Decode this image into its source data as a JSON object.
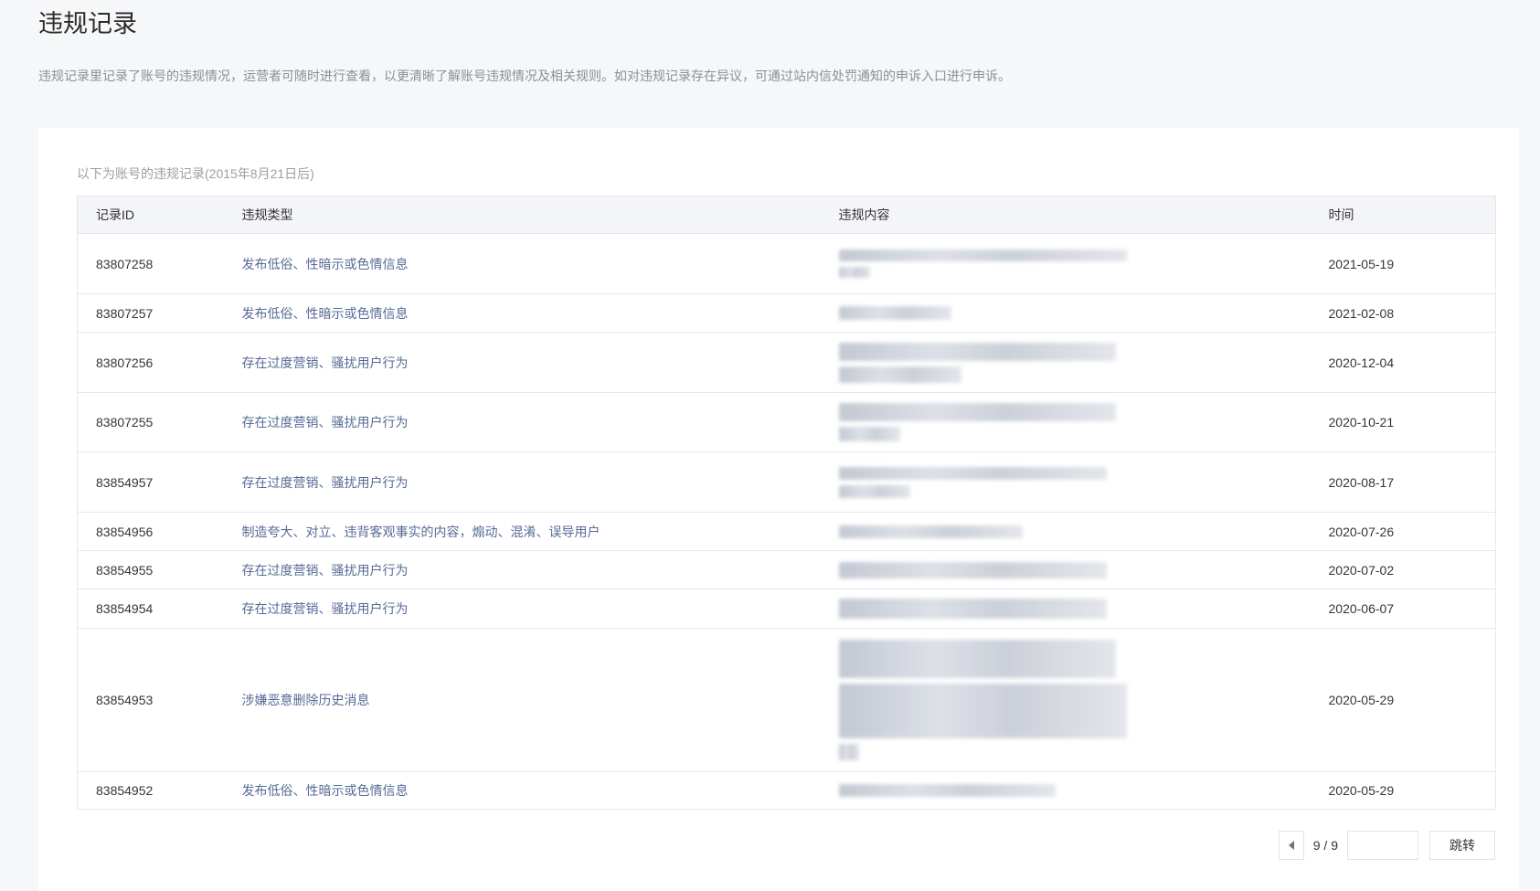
{
  "page": {
    "title": "违规记录",
    "description": "违规记录里记录了账号的违规情况，运营者可随时进行查看，以更清晰了解账号违规情况及相关规则。如对违规记录存在异议，可通过站内信处罚通知的申诉入口进行申诉。"
  },
  "table": {
    "caption": "以下为账号的违规记录(2015年8月21日后)",
    "headers": {
      "id": "记录ID",
      "type": "违规类型",
      "content": "违规内容",
      "time": "时间"
    },
    "rows": [
      {
        "id": "83807258",
        "type": "发布低俗、性暗示或色情信息",
        "time": "2021-05-19"
      },
      {
        "id": "83807257",
        "type": "发布低俗、性暗示或色情信息",
        "time": "2021-02-08"
      },
      {
        "id": "83807256",
        "type": "存在过度营销、骚扰用户行为",
        "time": "2020-12-04"
      },
      {
        "id": "83807255",
        "type": "存在过度营销、骚扰用户行为",
        "time": "2020-10-21"
      },
      {
        "id": "83854957",
        "type": "存在过度营销、骚扰用户行为",
        "time": "2020-08-17"
      },
      {
        "id": "83854956",
        "type": "制造夸大、对立、违背客观事实的内容，煽动、混淆、误导用户",
        "time": "2020-07-26"
      },
      {
        "id": "83854955",
        "type": "存在过度营销、骚扰用户行为",
        "time": "2020-07-02"
      },
      {
        "id": "83854954",
        "type": "存在过度营销、骚扰用户行为",
        "time": "2020-06-07"
      },
      {
        "id": "83854953",
        "type": "涉嫌恶意删除历史消息",
        "time": "2020-05-29"
      },
      {
        "id": "83854952",
        "type": "发布低俗、性暗示或色情信息",
        "time": "2020-05-29"
      }
    ]
  },
  "pagination": {
    "page_indicator": "9 / 9",
    "input_value": "",
    "jump_label": "跳转",
    "prev_icon": "caret-left-icon"
  }
}
